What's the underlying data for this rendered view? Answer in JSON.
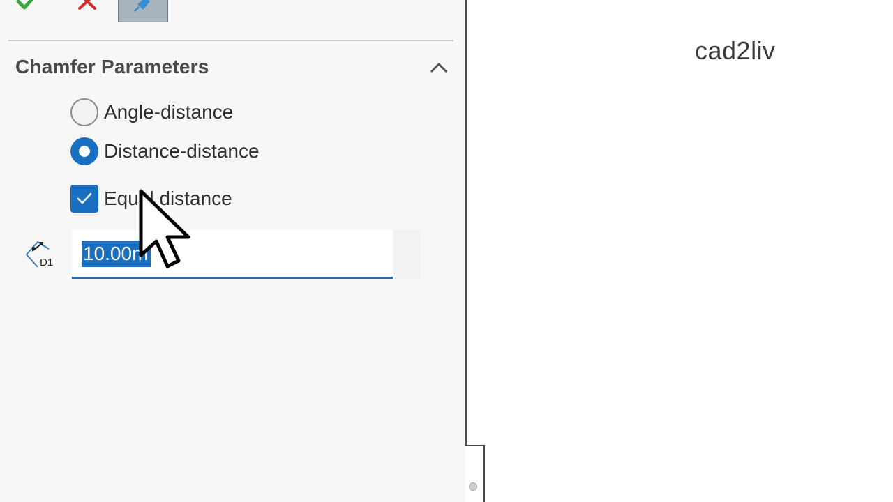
{
  "chamfer_parameters": {
    "title": "Chamfer Parameters",
    "options": [
      {
        "label": "Angle-distance",
        "selected": false
      },
      {
        "label": "Distance-distance",
        "selected": true
      }
    ],
    "equal_distance": {
      "label": "Equal distance",
      "checked": true
    },
    "distance_input": {
      "value": "10.00m",
      "icon": "distance-d1-icon",
      "icon_text": "D1"
    }
  },
  "watermark": "cad2liv",
  "colors": {
    "accent": "#1b6fc0",
    "ok": "#3aa63a",
    "cancel": "#d42a2a"
  }
}
